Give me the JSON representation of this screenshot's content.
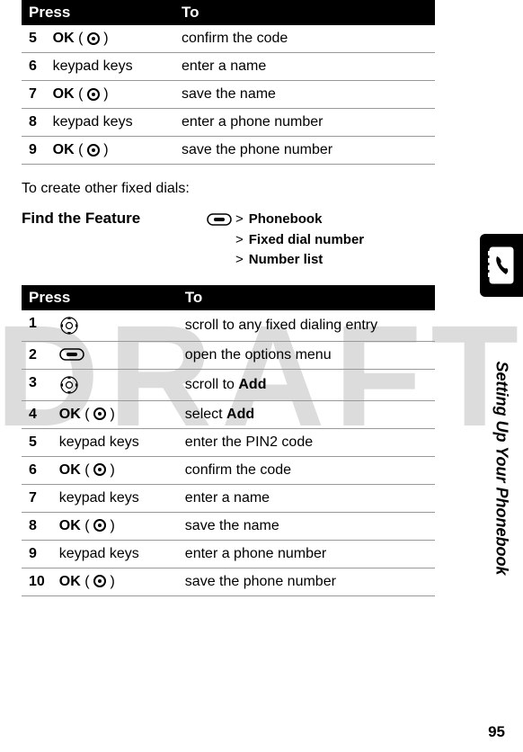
{
  "watermark": "DRAFT",
  "table_header": {
    "press": "Press",
    "to": "To"
  },
  "table1": [
    {
      "num": "5",
      "press": "OK",
      "suffix": "( ◎ )",
      "to": "confirm the code"
    },
    {
      "num": "6",
      "press": "keypad keys",
      "suffix": "",
      "to": "enter a name"
    },
    {
      "num": "7",
      "press": "OK",
      "suffix": "( ◎ )",
      "to": "save the name"
    },
    {
      "num": "8",
      "press": "keypad keys",
      "suffix": "",
      "to": "enter a phone number"
    },
    {
      "num": "9",
      "press": "OK",
      "suffix": "( ◎ )",
      "to": "save the phone number"
    }
  ],
  "intro": "To create other fixed dials:",
  "feature_label": "Find the Feature",
  "feature_path": {
    "line1_prefix": ">",
    "line1": "Phonebook",
    "line2_prefix": ">",
    "line2": "Fixed dial number",
    "line3_prefix": ">",
    "line3": "Number list"
  },
  "table2": [
    {
      "num": "1",
      "press_icon": "dpad",
      "press": "",
      "to": "scroll to any fixed dialing entry"
    },
    {
      "num": "2",
      "press_icon": "softkey",
      "press": "",
      "to": "open the options menu"
    },
    {
      "num": "3",
      "press_icon": "dpad",
      "press": "",
      "to_prefix": "scroll to ",
      "to_bold": "Add"
    },
    {
      "num": "4",
      "press": "OK",
      "suffix": "( ◎ )",
      "to_prefix": "select ",
      "to_bold": "Add"
    },
    {
      "num": "5",
      "press": "keypad keys",
      "suffix": "",
      "to": "enter the PIN2 code"
    },
    {
      "num": "6",
      "press": "OK",
      "suffix": "( ◎ )",
      "to": "confirm the code"
    },
    {
      "num": "7",
      "press": "keypad keys",
      "suffix": "",
      "to": "enter a name"
    },
    {
      "num": "8",
      "press": "OK",
      "suffix": "( ◎ )",
      "to": "save the name"
    },
    {
      "num": "9",
      "press": "keypad keys",
      "suffix": "",
      "to": "enter a phone number"
    },
    {
      "num": "10",
      "press": "OK",
      "suffix": "( ◎ )",
      "to": "save the phone number"
    }
  ],
  "side_text": "Setting Up Your Phonebook",
  "page_number": "95"
}
